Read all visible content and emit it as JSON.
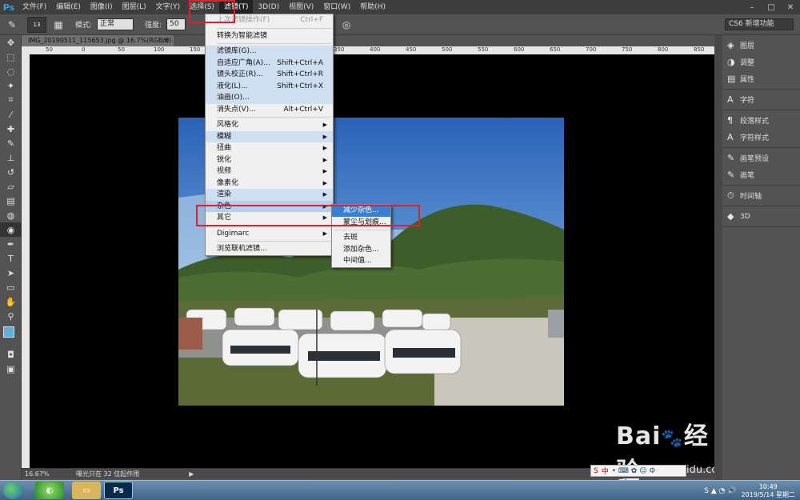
{
  "app": {
    "logo": "Ps"
  },
  "menubar": {
    "items": [
      "文件(F)",
      "编辑(E)",
      "图像(I)",
      "图层(L)",
      "文字(Y)",
      "选择(S)",
      "滤镜(T)",
      "3D(D)",
      "视图(V)",
      "窗口(W)",
      "帮助(H)"
    ],
    "active_index": 6
  },
  "window_controls": {
    "minimize": "–",
    "restore": "□",
    "close": "✕"
  },
  "options": {
    "brush_size": "13",
    "mode_label": "模式:",
    "mode_value": "正常",
    "strength_label": "强度:",
    "strength_value": "50",
    "workspace": "CS6 新增功能"
  },
  "document": {
    "tab_title": "IMG_20190511_115653.jpg @ 16.7%(RGB/8)",
    "tab_close": "×",
    "ruler_ticks": [
      "50",
      "0",
      "50",
      "100",
      "150",
      "200",
      "250",
      "300",
      "350",
      "400",
      "450",
      "500",
      "550",
      "600",
      "650",
      "700",
      "750",
      "800",
      "850"
    ]
  },
  "status": {
    "zoom": "16.67%",
    "info": "曝光只在 32 位起作用"
  },
  "filter_menu": {
    "items": [
      {
        "label": "上次滤镜操作(F)",
        "shortcut": "Ctrl+F",
        "disabled": true
      },
      {
        "sep": true
      },
      {
        "label": "转换为智能滤镜"
      },
      {
        "sep": true
      },
      {
        "label": "滤镜库(G)...",
        "hl": true
      },
      {
        "label": "自适应广角(A)...",
        "shortcut": "Shift+Ctrl+A",
        "hl": true
      },
      {
        "label": "镜头校正(R)...",
        "shortcut": "Shift+Ctrl+R",
        "hl": true
      },
      {
        "label": "液化(L)...",
        "shortcut": "Shift+Ctrl+X",
        "hl": true
      },
      {
        "label": "油画(O)...",
        "hl": true
      },
      {
        "label": "消失点(V)...",
        "shortcut": "Alt+Ctrl+V"
      },
      {
        "sep": true
      },
      {
        "label": "风格化",
        "sub": true
      },
      {
        "label": "模糊",
        "sub": true,
        "hl": true
      },
      {
        "label": "扭曲",
        "sub": true
      },
      {
        "label": "锐化",
        "sub": true
      },
      {
        "label": "视频",
        "sub": true
      },
      {
        "label": "像素化",
        "sub": true
      },
      {
        "label": "渲染",
        "sub": true,
        "hl": true
      },
      {
        "label": "杂色",
        "sub": true,
        "hl": true,
        "strong": true
      },
      {
        "label": "其它",
        "sub": true
      },
      {
        "sep": true
      },
      {
        "label": "Digimarc",
        "sub": true
      },
      {
        "sep": true
      },
      {
        "label": "浏览联机滤镜..."
      }
    ]
  },
  "noise_submenu": {
    "items": [
      "减少杂色...",
      "蒙尘与划痕...",
      "去斑",
      "添加杂色...",
      "中间值..."
    ],
    "highlighted_index": 0
  },
  "panels": {
    "groups": [
      [
        "图层",
        "调整",
        "属性"
      ],
      [
        "字符"
      ],
      [
        "段落样式",
        "字符样式"
      ],
      [
        "画笔预设",
        "画笔"
      ],
      [
        "时间轴"
      ],
      [
        "3D"
      ]
    ]
  },
  "taskbar": {
    "clock_time": "10:49",
    "clock_date": "2019/5/14 星期二"
  },
  "watermark": {
    "brand": "Bai",
    "brand2": "经验",
    "url": "jingyan.baidu.com"
  },
  "ime": {
    "label": "中"
  }
}
